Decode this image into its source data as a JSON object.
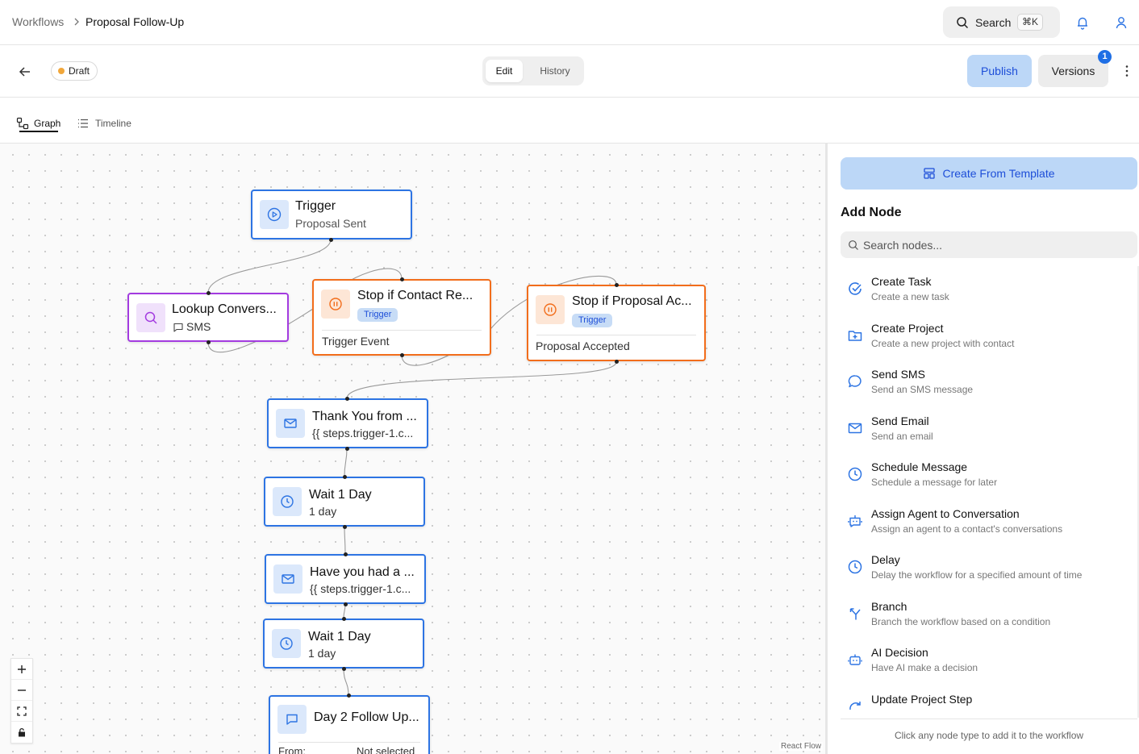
{
  "breadcrumb": {
    "root": "Workflows",
    "current": "Proposal Follow-Up"
  },
  "topbar": {
    "search_label": "Search",
    "search_shortcut": "⌘K"
  },
  "editbar": {
    "status": "Draft",
    "tabs": {
      "edit": "Edit",
      "history": "History"
    },
    "publish": "Publish",
    "versions": "Versions",
    "versions_badge": "1"
  },
  "views": {
    "graph": "Graph",
    "timeline": "Timeline"
  },
  "nodes": {
    "trigger": {
      "title": "Trigger",
      "subtitle": "Proposal Sent"
    },
    "lookup": {
      "title": "Lookup Convers...",
      "subtitle": "SMS"
    },
    "stop1": {
      "title": "Stop if Contact Re...",
      "tag": "Trigger",
      "detail": "Trigger Event"
    },
    "stop2": {
      "title": "Stop if Proposal Ac...",
      "tag": "Trigger",
      "detail": "Proposal Accepted"
    },
    "email1": {
      "title": "Thank You from ...",
      "subtitle": "{{ steps.trigger-1.c..."
    },
    "wait1": {
      "title": "Wait 1 Day",
      "subtitle": "1 day"
    },
    "email2": {
      "title": "Have you had a ...",
      "subtitle": "{{ steps.trigger-1.c..."
    },
    "wait2": {
      "title": "Wait 1 Day",
      "subtitle": "1 day"
    },
    "sms": {
      "title": "Day 2 Follow Up...",
      "from_label": "From:",
      "from_value": "Not selected"
    }
  },
  "canvas": {
    "attribution": "React Flow"
  },
  "panel": {
    "create_template": "Create From Template",
    "heading": "Add Node",
    "search_placeholder": "Search nodes...",
    "items": [
      {
        "title": "Create Task",
        "desc": "Create a new task",
        "icon": "check-circle-icon"
      },
      {
        "title": "Create Project",
        "desc": "Create a new project with contact",
        "icon": "folder-plus-icon"
      },
      {
        "title": "Send SMS",
        "desc": "Send an SMS message",
        "icon": "chat-bubble-icon"
      },
      {
        "title": "Send Email",
        "desc": "Send an email",
        "icon": "mail-icon"
      },
      {
        "title": "Schedule Message",
        "desc": "Schedule a message for later",
        "icon": "clock-icon"
      },
      {
        "title": "Assign Agent to Conversation",
        "desc": "Assign an agent to a contact's conversations",
        "icon": "bot-message-icon"
      },
      {
        "title": "Delay",
        "desc": "Delay the workflow for a specified amount of time",
        "icon": "clock-icon"
      },
      {
        "title": "Branch",
        "desc": "Branch the workflow based on a condition",
        "icon": "split-icon"
      },
      {
        "title": "AI Decision",
        "desc": "Have AI make a decision",
        "icon": "bot-icon"
      },
      {
        "title": "Update Project Step",
        "desc": "",
        "icon": "refresh-icon"
      }
    ],
    "footer": "Click any node type to add it to the workflow"
  },
  "colors": {
    "accent": "#2d74e3",
    "lookup": "#a33be0",
    "stop": "#f26d1b",
    "primary_button": "#bcd7f7"
  }
}
